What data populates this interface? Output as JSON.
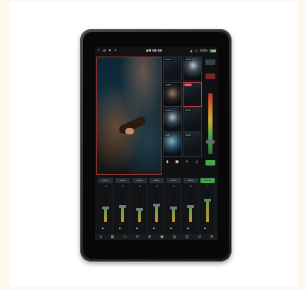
{
  "status_bar": {
    "clock": "AM 09:00",
    "battery": "100%",
    "left_icons": [
      "wifi-icon",
      "signal-icon",
      "record-dot-icon",
      "settings-icon"
    ],
    "right_icons": [
      "lock-icon",
      "network-icon"
    ]
  },
  "colors": {
    "program_border": "#b23a3a",
    "meter_green": "#4fa14a",
    "meter_orange": "#d58c2e",
    "active_channel": "#4aa34d"
  },
  "previews": [
    {
      "label": "CAM1"
    },
    {
      "label": "CAM2"
    },
    {
      "label": "CAM3"
    },
    {
      "label": "CAM4"
    },
    {
      "label": "CAM5"
    },
    {
      "label": "CAM6"
    },
    {
      "label": "CAM7"
    },
    {
      "label": "CAM8"
    }
  ],
  "preview_tools": [
    "trash-icon",
    "square-icon",
    "pen-icon",
    "mic-icon"
  ],
  "channels": [
    {
      "name": "CAM 1",
      "db": "-20",
      "level": 0.45
    },
    {
      "name": "CAM 2",
      "db": "-18",
      "level": 0.5
    },
    {
      "name": "CAM 3",
      "db": "-22",
      "level": 0.4
    },
    {
      "name": "CAM 4",
      "db": "-15",
      "level": 0.55
    },
    {
      "name": "CAM 5",
      "db": "-20",
      "level": 0.45
    },
    {
      "name": "CAM 6",
      "db": "-19",
      "level": 0.5
    },
    {
      "name": "MASTER",
      "db": "0",
      "level": 0.7,
      "active": true
    }
  ],
  "bottom_icons": [
    "home-icon",
    "grid-icon",
    "monitor-icon",
    "layers-icon",
    "menu-icon",
    "image-icon",
    "folder-icon",
    "user-icon",
    "stack-icon",
    "settings-icon"
  ]
}
